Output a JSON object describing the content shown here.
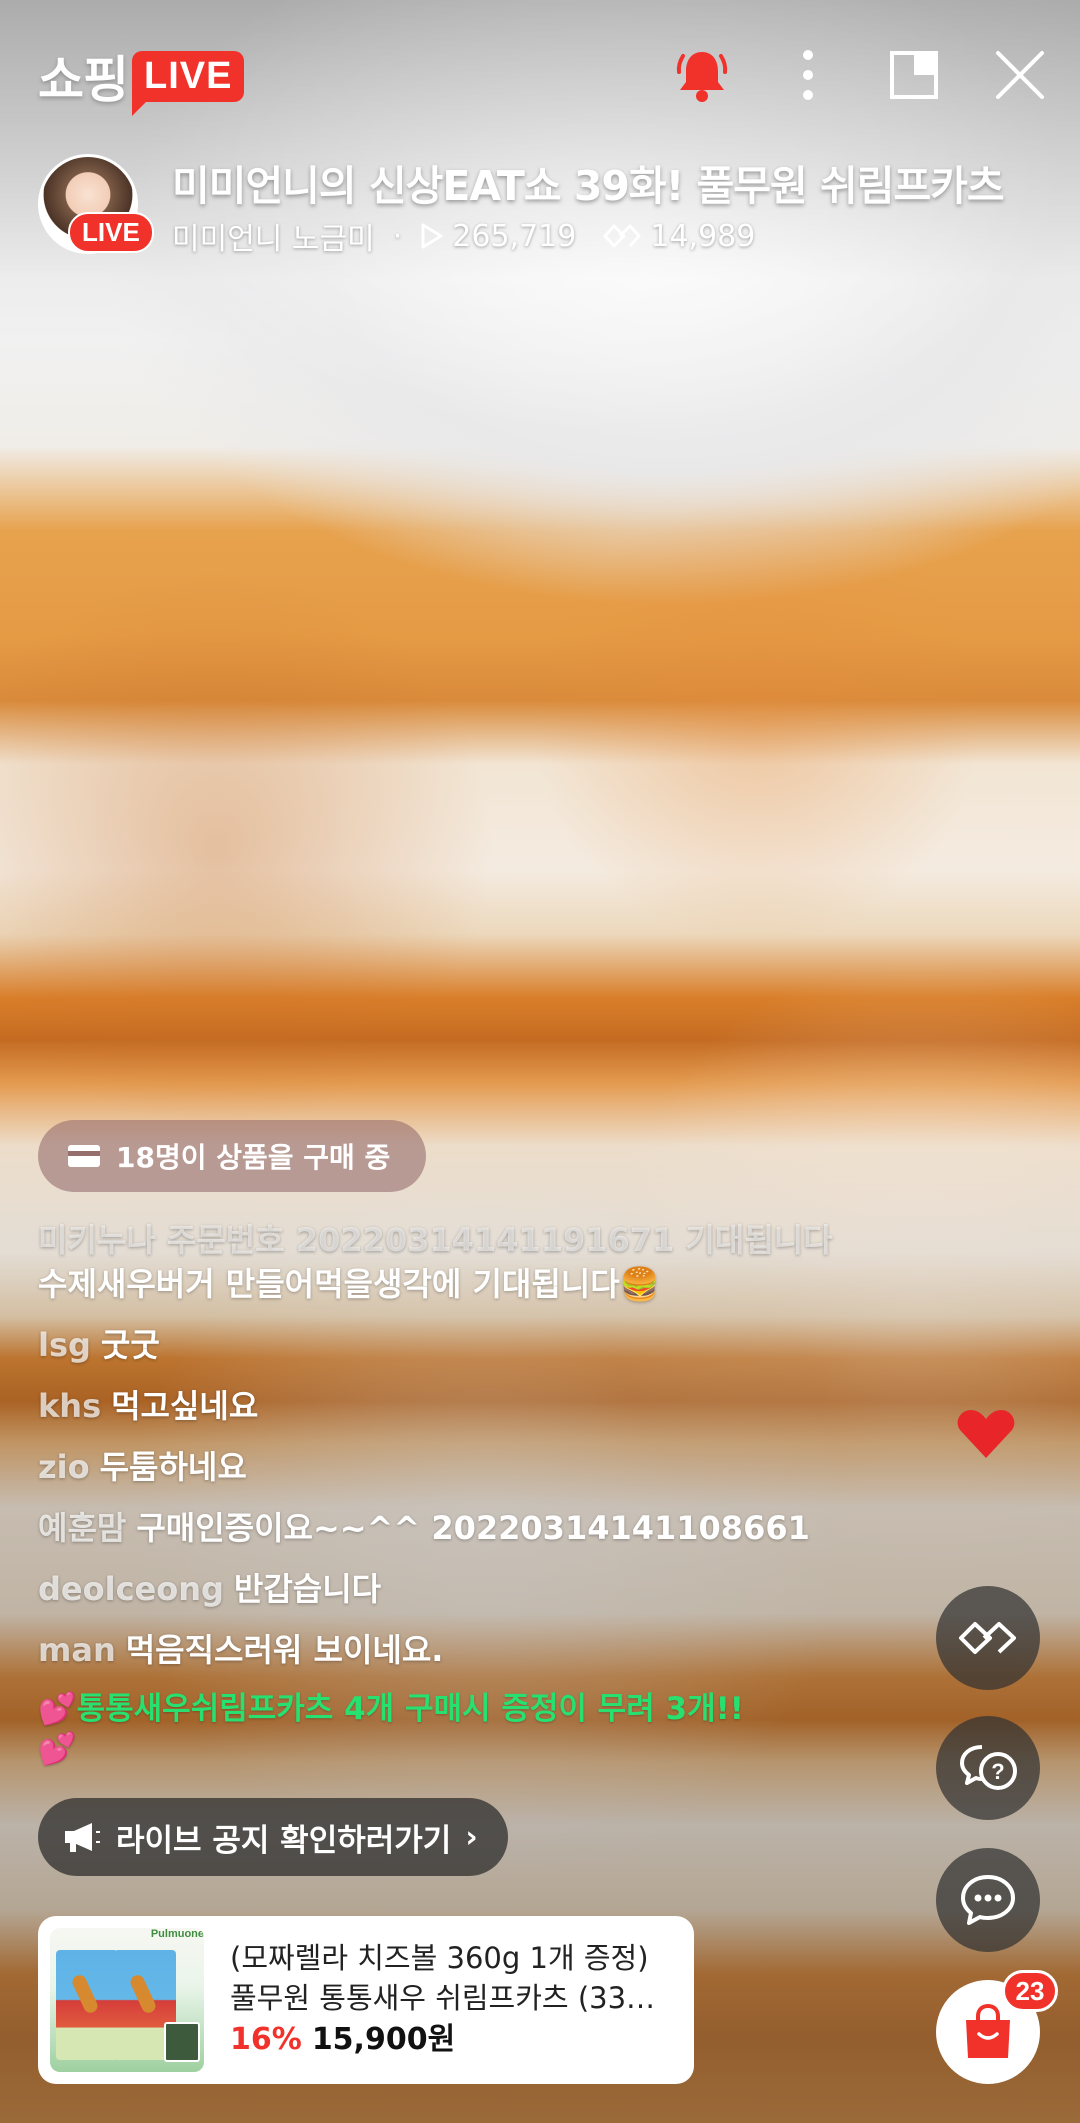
{
  "header": {
    "logo_text": "쇼핑",
    "logo_badge": "LIVE",
    "icons": [
      "bell-icon",
      "more-vertical-icon",
      "picture-in-picture-icon",
      "close-icon"
    ],
    "accent_color": "#f1322b"
  },
  "channel": {
    "avatar_badge": "LIVE",
    "title": "미미언니의 신상EAT쇼 39화! 풀무원 쉬림프카츠",
    "host": "미미언니 노금미",
    "separator": "·",
    "views": "265,719",
    "likes": "14,989"
  },
  "buying_notice": "18명이 상품을 구매 중",
  "chat": [
    {
      "user": "",
      "text": "미키누나 주문번호 20220314141191671 기대됩니다"
    },
    {
      "user": "",
      "text": "수제새우버거 만들어먹을생각에 기대됩니다🍔"
    },
    {
      "user": "lsg",
      "text": "굿굿"
    },
    {
      "user": "khs",
      "text": "먹고싶네요"
    },
    {
      "user": "zio",
      "text": "두툼하네요"
    },
    {
      "user": "예훈맘",
      "text": "구매인증이요~~^^ 20220314141108661"
    },
    {
      "user": "deolceong",
      "text": "반갑습니다"
    },
    {
      "user": "man",
      "text": "먹음직스러워 보이네요."
    }
  ],
  "promo_notice": {
    "prefix": "💕",
    "text": "통통새우쉬림프카츠 4개 구매시 증정이 무려 3개!!",
    "suffix": "💕",
    "color": "#27e070"
  },
  "announcement": {
    "label": "라이브 공지 확인하러가기",
    "chevron": "›"
  },
  "product": {
    "brand": "Pulmuone",
    "subtitle": "(모짜렐라 치즈볼 360g 1개 증정)",
    "name": "풀무원 통통새우 쉬림프카츠 (33…",
    "discount": "16%",
    "price": "15,900원"
  },
  "side_buttons": [
    "heart-icon",
    "like-hands-icon",
    "question-chat-icon",
    "chat-icon"
  ],
  "cart": {
    "badge": "23"
  }
}
